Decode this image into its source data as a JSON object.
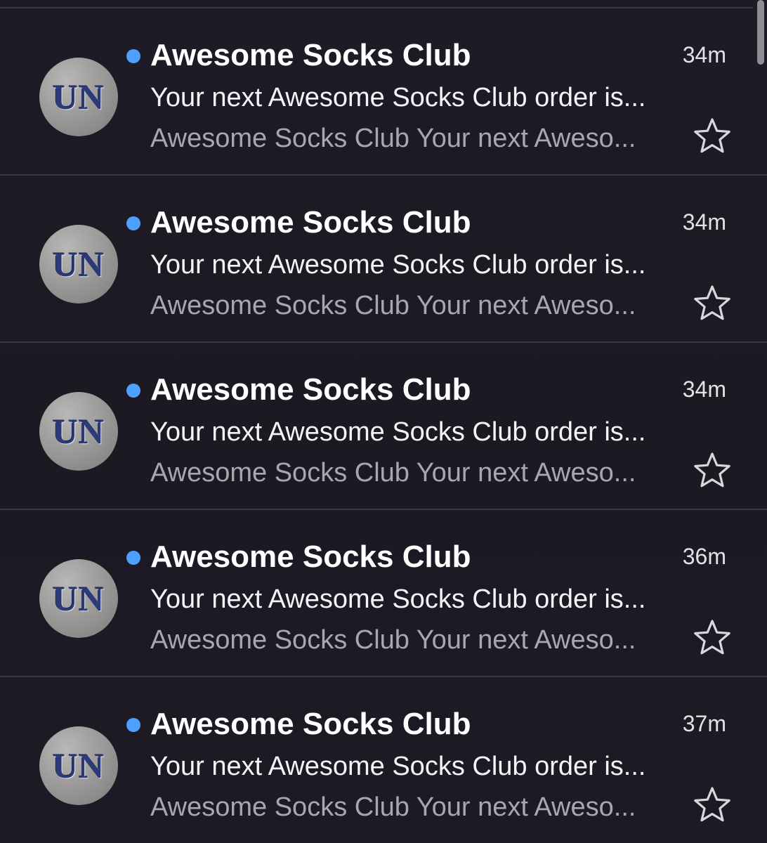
{
  "theme": {
    "background": "#1d1a24",
    "divider": "#3a3742",
    "unread_dot": "#4da0ff",
    "sender_color": "#ffffff",
    "subject_color": "#f4f3f7",
    "preview_color": "#a8a6ae",
    "avatar_text_color": "#2c3a78"
  },
  "emails": [
    {
      "avatar_text": "UN",
      "unread": true,
      "sender": "Awesome Socks Club",
      "time": "34m",
      "subject": "Your next Awesome Socks Club order is...",
      "preview": "Awesome Socks Club Your next Aweso...",
      "starred": false,
      "star_icon": "star-outline-icon"
    },
    {
      "avatar_text": "UN",
      "unread": true,
      "sender": "Awesome Socks Club",
      "time": "34m",
      "subject": "Your next Awesome Socks Club order is...",
      "preview": "Awesome Socks Club Your next Aweso...",
      "starred": false,
      "star_icon": "star-outline-icon"
    },
    {
      "avatar_text": "UN",
      "unread": true,
      "sender": "Awesome Socks Club",
      "time": "34m",
      "subject": "Your next Awesome Socks Club order is...",
      "preview": "Awesome Socks Club Your next Aweso...",
      "starred": false,
      "star_icon": "star-outline-icon"
    },
    {
      "avatar_text": "UN",
      "unread": true,
      "sender": "Awesome Socks Club",
      "time": "36m",
      "subject": "Your next Awesome Socks Club order is...",
      "preview": "Awesome Socks Club Your next Aweso...",
      "starred": false,
      "star_icon": "star-outline-icon"
    },
    {
      "avatar_text": "UN",
      "unread": true,
      "sender": "Awesome Socks Club",
      "time": "37m",
      "subject": "Your next Awesome Socks Club order is...",
      "preview": "Awesome Socks Club Your next Aweso...",
      "starred": false,
      "star_icon": "star-outline-icon"
    }
  ]
}
